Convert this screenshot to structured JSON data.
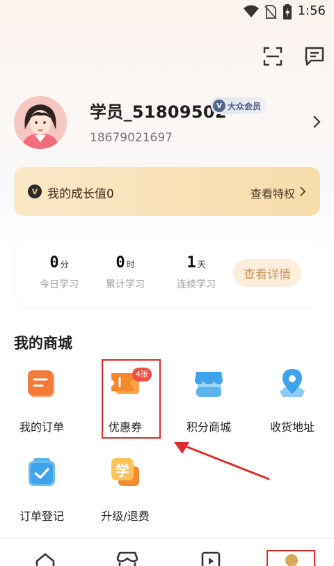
{
  "status_bar": {
    "time": "1:56"
  },
  "profile": {
    "username": "学员_51809502",
    "member_level": "大众会员",
    "phone": "18679021697"
  },
  "growth": {
    "badge_letter": "V",
    "label": "我的成长值0",
    "link": "查看特权"
  },
  "stats": {
    "items": [
      {
        "value": "0",
        "unit": "分",
        "label": "今日学习"
      },
      {
        "value": "0",
        "unit": "时",
        "label": "累计学习"
      },
      {
        "value": "1",
        "unit": "天",
        "label": "连续学习"
      }
    ],
    "detail_button": "查看详情"
  },
  "mall": {
    "title": "我的商城",
    "items": [
      {
        "label": "我的订单",
        "icon": "order-icon"
      },
      {
        "label": "优惠券",
        "icon": "coupon-icon",
        "badge": "4张"
      },
      {
        "label": "积分商城",
        "icon": "shop-icon"
      },
      {
        "label": "收货地址",
        "icon": "location-icon"
      },
      {
        "label": "订单登记",
        "icon": "register-icon"
      },
      {
        "label": "升级/退费",
        "icon": "upgrade-icon",
        "glyph": "学"
      }
    ]
  },
  "tab_bar": {
    "items": [
      {
        "icon": "home-icon"
      },
      {
        "icon": "store-icon"
      },
      {
        "icon": "video-icon"
      },
      {
        "icon": "profile-icon"
      }
    ]
  },
  "colors": {
    "accent_gold": "#c79a5c",
    "orange": "#f47a3c",
    "blue": "#3ea3e8",
    "badge_red": "#ef4f42",
    "annotation_red": "#e02a2a"
  }
}
